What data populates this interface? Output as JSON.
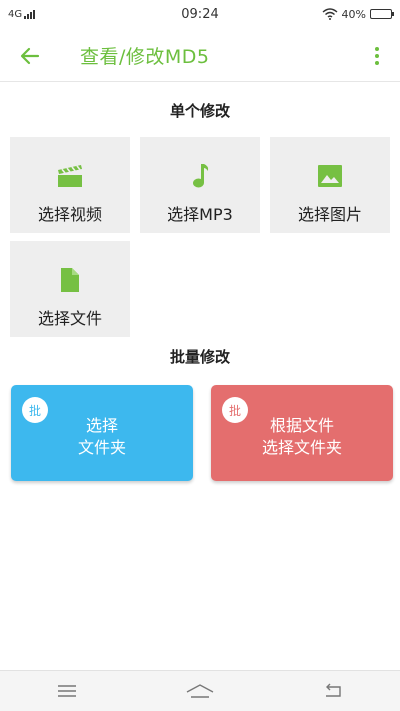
{
  "status_bar": {
    "network": "4G",
    "time": "09:24",
    "battery": "40%",
    "battery_level": 0.4
  },
  "app_bar": {
    "title": "查看/修改MD5",
    "back_icon": "arrow-left-icon",
    "menu_icon": "more-vert-icon"
  },
  "single": {
    "heading": "单个修改",
    "items": [
      {
        "label": "选择视频",
        "icon": "film-icon"
      },
      {
        "label": "选择MP3",
        "icon": "music-note-icon"
      },
      {
        "label": "选择图片",
        "icon": "image-icon"
      },
      {
        "label": "选择文件",
        "icon": "file-icon"
      }
    ]
  },
  "batch": {
    "heading": "批量修改",
    "items": [
      {
        "badge": "批",
        "line1": "选择",
        "line2": "文件夹",
        "color": "#3db8ee"
      },
      {
        "badge": "批",
        "line1": "根据文件",
        "line2": "选择文件夹",
        "color": "#e46e6e"
      }
    ]
  },
  "colors": {
    "accent": "#6cbf3e",
    "tile_bg": "#eeeeee"
  },
  "nav_bar": {
    "icons": [
      "menu-icon",
      "home-icon",
      "back-icon"
    ]
  }
}
